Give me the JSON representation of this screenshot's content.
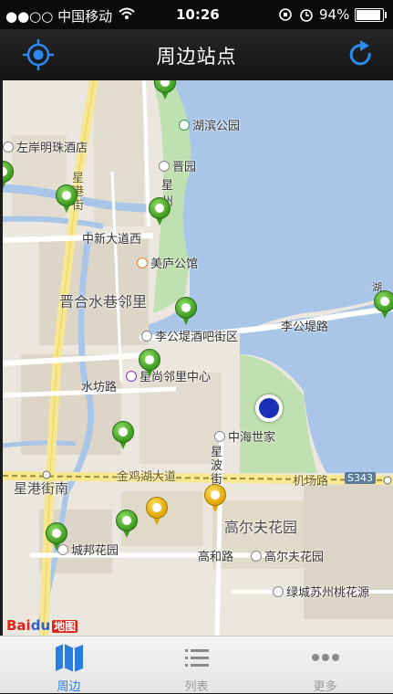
{
  "status": {
    "carrier": "●●○○ 中国移动",
    "time": "10:26",
    "battery": "94%"
  },
  "navbar": {
    "title": "周边站点",
    "left_icon": "locate-icon",
    "right_icon": "refresh-icon"
  },
  "map": {
    "labels": {
      "hubin_park": "湖滨公园",
      "zuoan_hotel": "左岸明珠酒店",
      "jinyuan": "晋园",
      "xing1": "星",
      "zhou1": "州",
      "xinggang_jie": "星港街",
      "zhongxin_dadao": "中新大道西",
      "meilu": "美庐公馆",
      "jinhe": "晋合水巷邻里",
      "ligongdi_bar": "李公堤酒吧街区",
      "ligongdi_road": "李公堤路",
      "shuifang": "水坊路",
      "xingshang": "星尚邻里中心",
      "zhonghai": "中海世家",
      "xingbo": "星波街",
      "jinjihu": "金鸡湖大道",
      "jichang": "机场路",
      "s343": "S343",
      "xinggang_jienan": "星港街南",
      "golf_garden": "高尔夫花园",
      "chengbang": "城邦花园",
      "gaohe": "高和路",
      "golf_garden2": "高尔夫花园",
      "lvcheng": "绿城苏州桃花源",
      "hu": "湖"
    },
    "watermark": {
      "bai": "Bai",
      "du": "du",
      "ditu": "地图"
    }
  },
  "tabs": [
    {
      "label": "周边",
      "icon": "map-icon",
      "active": true
    },
    {
      "label": "列表",
      "icon": "list-icon",
      "active": false
    },
    {
      "label": "更多",
      "icon": "more-icon",
      "active": false
    }
  ]
}
